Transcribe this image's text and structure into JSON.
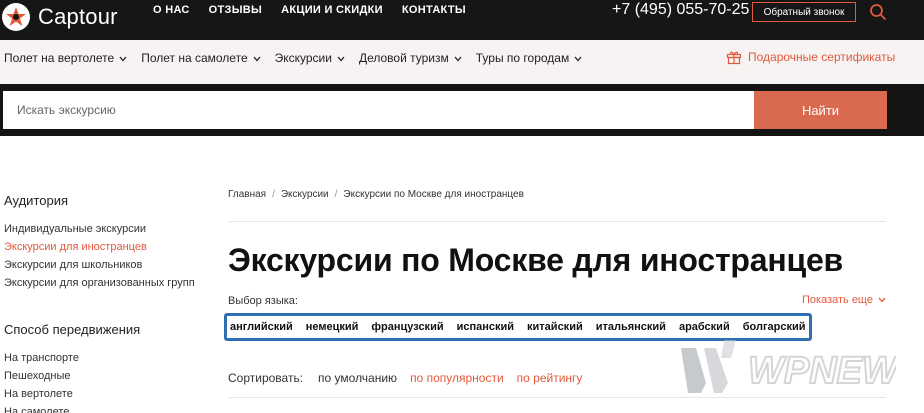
{
  "header": {
    "brand": "Captour",
    "nav": [
      "О НАС",
      "ОТЗЫВЫ",
      "АКЦИИ И СКИДКИ",
      "КОНТАКТЫ"
    ],
    "phone": "+7 (495) 055-70-25",
    "callback_label": "Обратный звонок",
    "search_icon": "search-icon"
  },
  "subnav": {
    "items": [
      "Полет на вертолете",
      "Полет на самолете",
      "Экскурсии",
      "Деловой туризм",
      "Туры по городам"
    ],
    "gift_label": "Подарочные сертификаты"
  },
  "search": {
    "placeholder": "Искать экскурсию",
    "button_label": "Найти"
  },
  "sidebar": {
    "audience_title": "Аудитория",
    "audience_items": [
      "Индивидуальные экскурсии",
      "Экскурсии для иностранцев",
      "Экскурсии для школьников",
      "Экскурсии для организованных групп"
    ],
    "active_index": 1,
    "transport_title": "Способ передвижения",
    "transport_items": [
      "На транспорте",
      "Пешеходные",
      "На вертолете",
      "На самолете"
    ]
  },
  "breadcrumb": [
    "Главная",
    "Экскурсии",
    "Экскурсии по Москве для иностранцев"
  ],
  "main": {
    "title": "Экскурсии по Москве для иностранцев",
    "language_label": "Выбор языка:",
    "show_more": "Показать еще",
    "languages": [
      "английский",
      "немецкий",
      "французский",
      "испанский",
      "китайский",
      "итальянский",
      "арабский",
      "болгарский"
    ],
    "sort_label": "Сортировать:",
    "sort_options": [
      "по умолчанию",
      "по популярности",
      "по рейтингу"
    ]
  },
  "watermark": "WPNEW",
  "colors": {
    "accent": "#e05a3c",
    "dark": "#161616",
    "highlight": "#2f6fb3"
  }
}
